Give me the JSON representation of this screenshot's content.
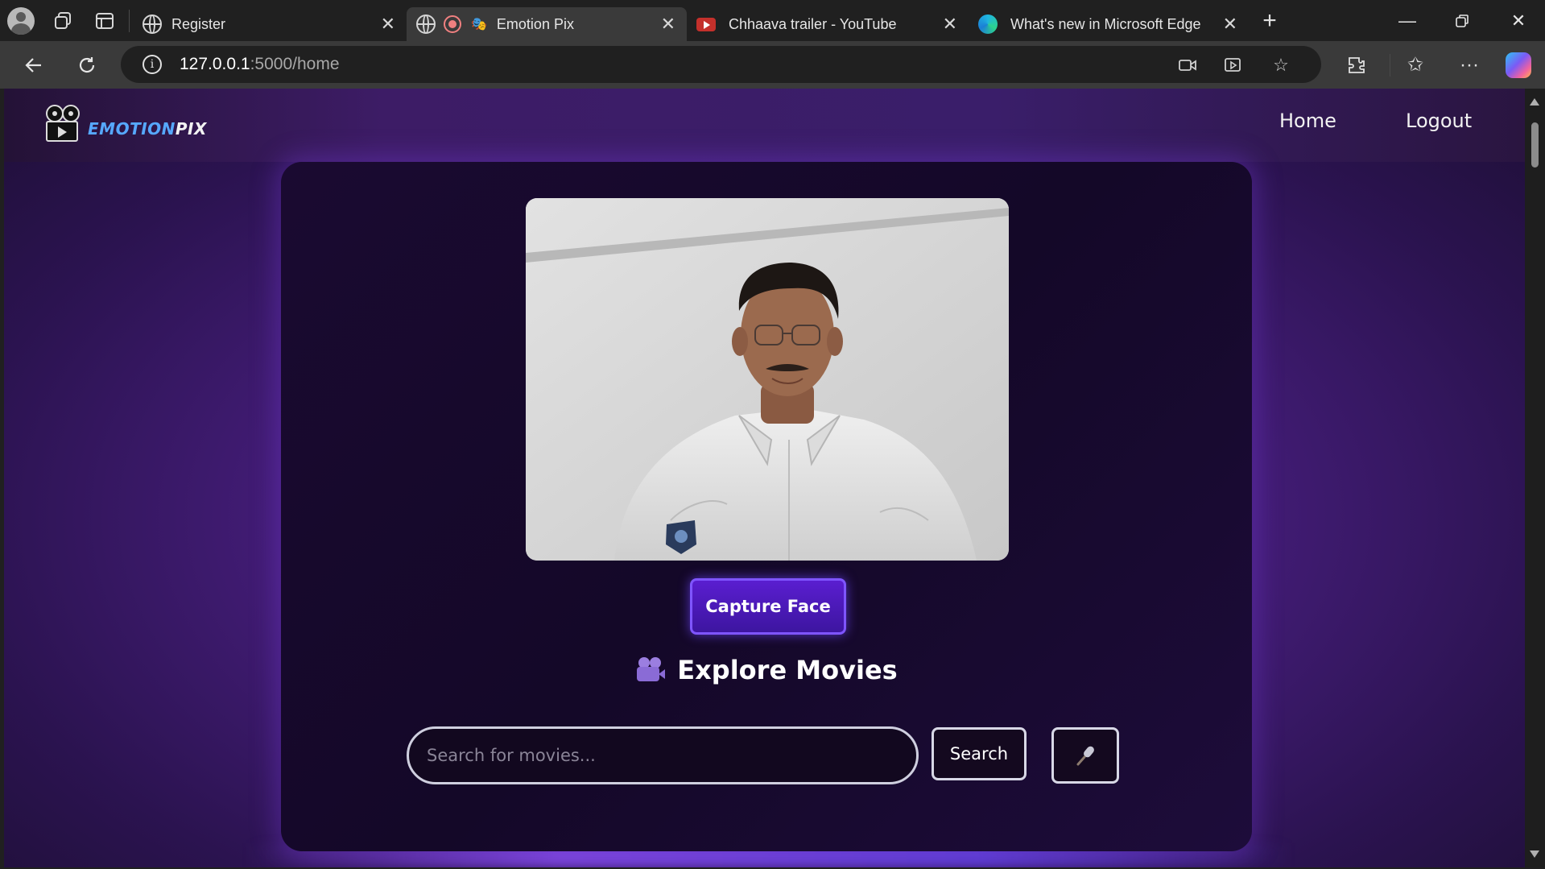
{
  "browser": {
    "tabs": [
      {
        "title": "Register",
        "icon": "globe-icon",
        "active": false
      },
      {
        "title": "Emotion Pix",
        "icon": "theater-masks-icon",
        "active": true,
        "recording": true
      },
      {
        "title": "Chhaava trailer - YouTube",
        "icon": "youtube-icon",
        "active": false
      },
      {
        "title": "What's new in Microsoft Edge",
        "icon": "edge-icon",
        "active": false
      }
    ],
    "url_host": "127.0.0.1",
    "url_path": ":5000/home"
  },
  "site": {
    "logo": {
      "part1": "EMOTION",
      "part2": "PIX"
    },
    "nav": {
      "home": "Home",
      "logout": "Logout"
    },
    "capture_label": "Capture Face",
    "explore_title": "Explore Movies",
    "search": {
      "placeholder": "Search for movies...",
      "button": "Search"
    }
  },
  "colors": {
    "accent": "#5a1ed0",
    "logo_blue": "#56a8ff",
    "background_purple": "#4a1f82"
  }
}
